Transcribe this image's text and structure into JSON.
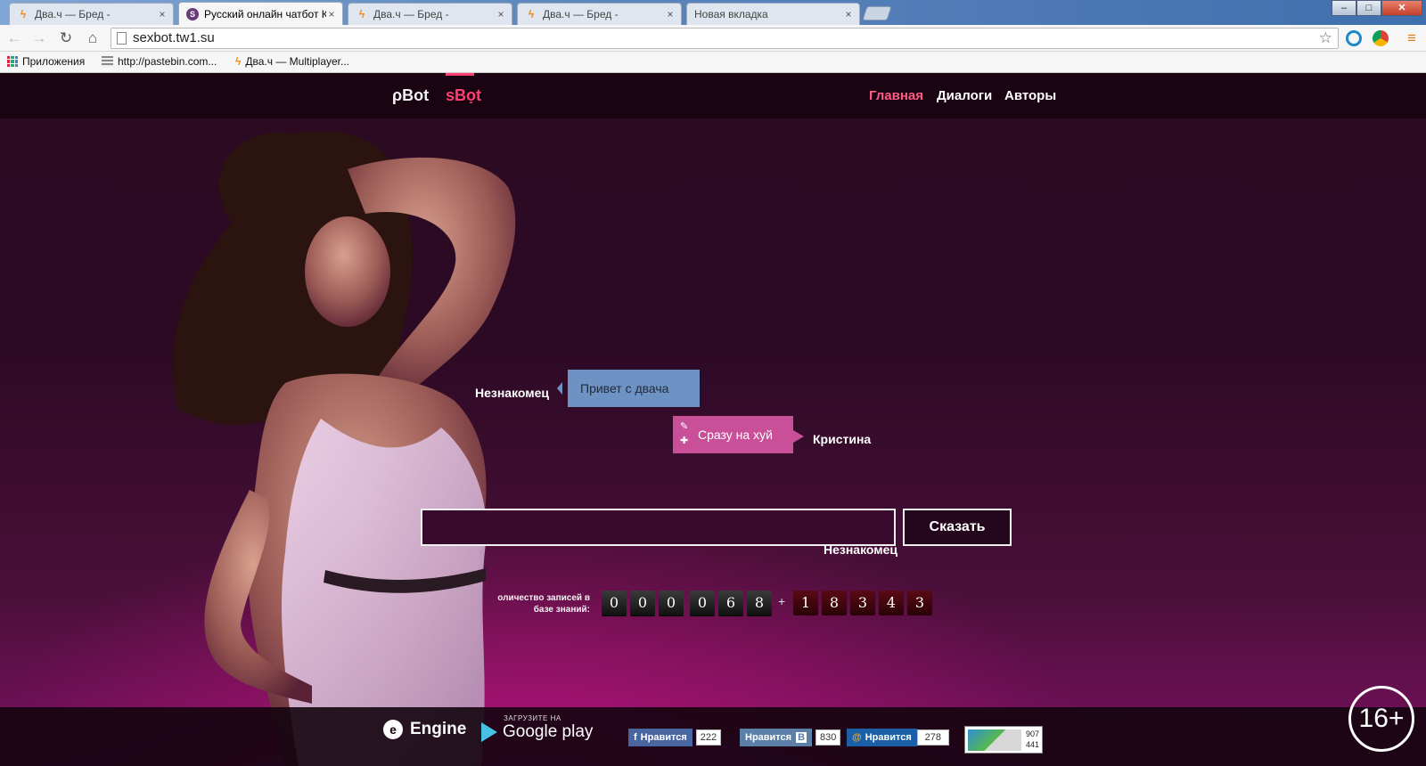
{
  "browser": {
    "tabs": [
      {
        "title": "Два.ч — Бред -",
        "icon": "bolt",
        "active": false
      },
      {
        "title": "Русский онлайн чатбот К",
        "icon": "s",
        "active": true
      },
      {
        "title": "Два.ч — Бред -",
        "icon": "bolt",
        "active": false
      },
      {
        "title": "Два.ч — Бред -",
        "icon": "bolt",
        "active": false
      },
      {
        "title": "Новая вкладка",
        "icon": "none",
        "active": false
      }
    ],
    "url": "sexbot.tw1.su",
    "bookmarks": [
      {
        "label": "Приложения",
        "icon": "apps-grid-icon"
      },
      {
        "label": "http://pastebin.com...",
        "icon": "pastebin-icon"
      },
      {
        "label": "Два.ч — Multiplayer...",
        "icon": "bolt-icon"
      }
    ],
    "tab_close": "×",
    "window_controls": {
      "min": "–",
      "max": "□",
      "close": "✕"
    }
  },
  "site": {
    "brand_p": "ρBot",
    "brand_s": "sBọt",
    "menu": [
      {
        "label": "Главная",
        "active": true
      },
      {
        "label": "Диалоги",
        "active": false
      },
      {
        "label": "Авторы",
        "active": false
      }
    ],
    "chat": {
      "user_name": "Незнакомец",
      "user_message": "Привет с двача",
      "bot_name": "Кристина",
      "bot_message": "Сразу на хуй",
      "bot_icons": {
        "edit": "✎",
        "add": "✚"
      }
    },
    "input": {
      "value": "",
      "button": "Сказать",
      "speaker_label": "Незнакомец"
    },
    "counter": {
      "label_line1": "оличество записей в",
      "label_line2": "базе знаний:",
      "digits_primary": [
        "0",
        "0",
        "0",
        "0",
        "6",
        "8"
      ],
      "plus": "+",
      "digits_secondary": [
        "1",
        "8",
        "3",
        "4",
        "3"
      ]
    },
    "footer": {
      "engine": "Engine",
      "engine_icon": "e-logo-icon",
      "gplay_small": "ЗАГРУЗИТЕ НА",
      "gplay_big": "Google play",
      "fb_label": "Нравится",
      "fb_count": "222",
      "vk_label": "Нравится",
      "vk_count": "830",
      "mr_label": "Нравится",
      "mr_count": "278",
      "badge_top": "907",
      "badge_bottom": "441"
    },
    "age_rating": "16+"
  }
}
